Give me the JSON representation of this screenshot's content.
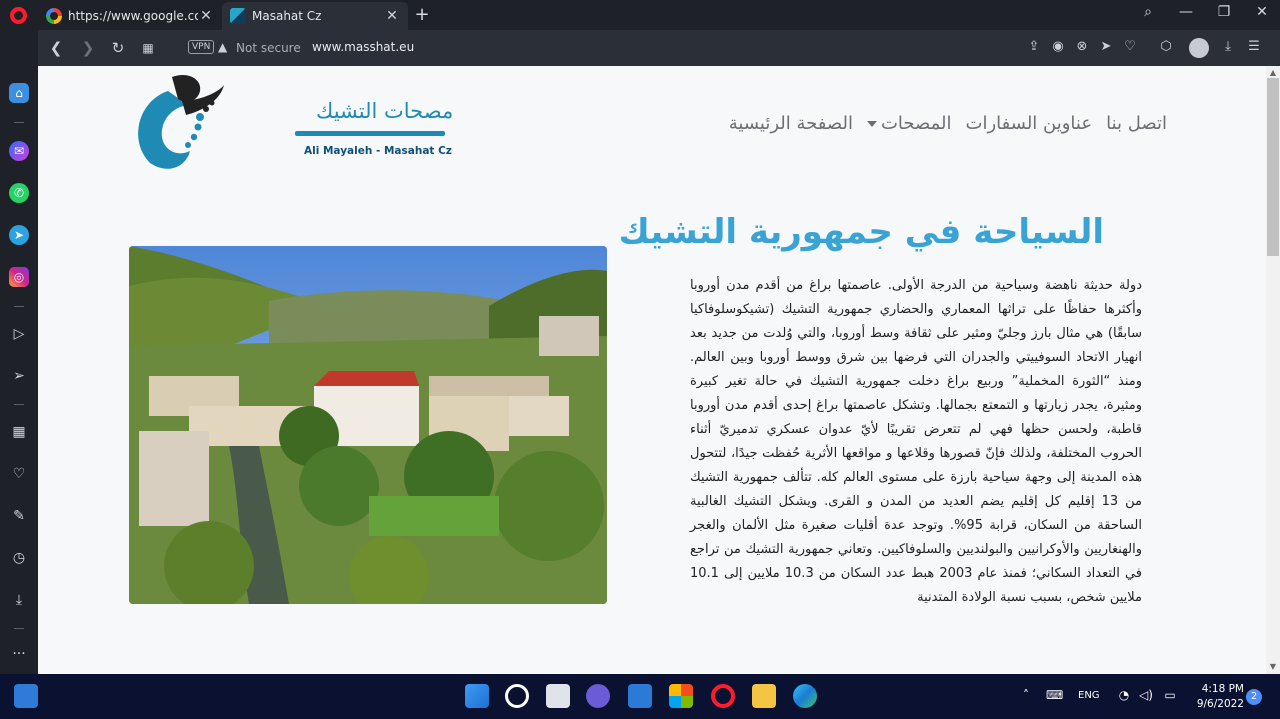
{
  "browser": {
    "tabs": [
      {
        "title": "https://www.google.com/se"
      },
      {
        "title": "Masahat Cz"
      }
    ],
    "vpn_label": "VPN",
    "security_label": "Not secure",
    "url": "www.masshat.eu"
  },
  "site": {
    "logo": {
      "title": "مصحات التشيك",
      "subtitle": "Ali Mayaleh - Masahat Cz"
    },
    "nav": [
      {
        "label": "الصفحة الرئيسية"
      },
      {
        "label": "المصحات"
      },
      {
        "label": "عناوين السفارات"
      },
      {
        "label": "اتصل بنا"
      }
    ],
    "heading": "السياحة في جمهورية التشيك",
    "article": "دولة حديثة ناهضة وسياحية من الدرجة الأولى. عاصمتها براغ من أقدم مدن أوروبا وأكثرها حفاظًا على تراثها المعماري والحضاري جمهورية التشيك (تشيكوسلوفاكيا سابقًا) هي مثال بارز وجليّ ومثير على ثقافة وسط أوروبا، والتي وُلدت من جديد بعد انهيار الاتحاد السوفييتي والجدران التي فرضها بين شرق ووسط أوروبا وبين العالم. ومنذ “الثورة المخملية” وربيع براغ دخلت جمهورية التشيك في حالة تغير كبيرة ومثيرة، يجدر زيارتها و التمعتع بجمالها. وتشكل عاصمتها براغ إحدى أقدم مدن أوروبا قاطبة، ولحسن حظها فهي لم تتعرض تقريبًا لأيّ عدوان عسكري تدميريّ أثناء الحروب المختلفة، ولذلك فإنّ قصورها وقلاعها و مواقعها الأثرية حُفظت جيدًا، لتتحول هذه المدينة إلى وجهة سياحية بارزة على مستوى العالم كله. تتألف جمهورية التشيك من 13 إقليم كل إقليم يضم العديد من المدن و القرى. ويشكل التشيك الغالبية الساحقة من السكان، قرابة 95%. وتوجد عدة أقليات صغيرة مثل الألمان والغجر والهنغاريين والأوكرانيين والبولنديين والسلوفاكيين. وتعاني جمهورية التشيك من تراجع في التعداد السكاني؛ فمنذ عام 2003 هبط عدد السكان من 10.3 ملايين إلى 10.1 ملايين شخص، بسبب نسبة الولادة المتدنية"
  },
  "taskbar": {
    "language": "ENG",
    "time": "4:18 PM",
    "date": "9/6/2022",
    "notification_count": "2"
  },
  "colors": {
    "accent": "#3aa3d6",
    "logo_blue": "#1f8bb4",
    "opera_red": "#ff1b2d"
  }
}
